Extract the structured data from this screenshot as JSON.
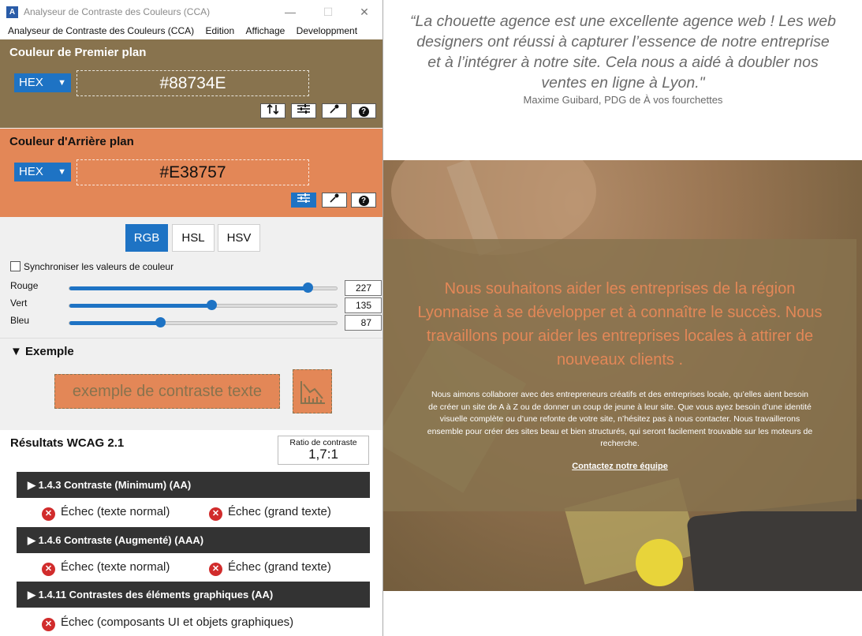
{
  "window": {
    "title": "Analyseur de Contraste des Couleurs (CCA)",
    "app_icon": "cca-logo-icon"
  },
  "menu": {
    "items": [
      "Analyseur de Contraste des Couleurs (CCA)",
      "Edition",
      "Affichage",
      "Developpment"
    ]
  },
  "foreground": {
    "title": "Couleur de Premier plan",
    "format": "HEX",
    "value": "#88734E",
    "color": "#88734e",
    "tools": [
      "swap-icon",
      "sliders-icon",
      "eyedropper-icon",
      "help-icon"
    ]
  },
  "background": {
    "title": "Couleur d'Arrière plan",
    "format": "HEX",
    "value": "#E38757",
    "color": "#e38757",
    "tools": [
      "sliders-icon",
      "eyedropper-icon",
      "help-icon"
    ]
  },
  "color_model": {
    "tabs": [
      "RGB",
      "HSL",
      "HSV"
    ],
    "selected": "RGB"
  },
  "sync_label": "Synchroniser les valeurs de couleur",
  "sliders": [
    {
      "label": "Rouge",
      "value": "227",
      "fraction": 0.89
    },
    {
      "label": "Vert",
      "value": "135",
      "fraction": 0.53
    },
    {
      "label": "Bleu",
      "value": "87",
      "fraction": 0.34
    }
  ],
  "example": {
    "heading": "▼ Exemple",
    "sample_text": "exemple de contraste texte"
  },
  "results": {
    "title": "Résultats WCAG 2.1",
    "ratio_label": "Ratio de contraste",
    "ratio_value": "1,7:1",
    "criteria": [
      {
        "label": "1.4.3 Contraste (Minimum) (AA)",
        "results": [
          "Échec (texte normal)",
          "Échec (grand texte)"
        ]
      },
      {
        "label": "1.4.6 Contraste (Augmenté) (AAA)",
        "results": [
          "Échec (texte normal)",
          "Échec (grand texte)"
        ]
      },
      {
        "label": "1.4.11 Contrastes des éléments graphiques (AA)",
        "results": [
          "Échec (composants UI et objets graphiques)"
        ]
      }
    ]
  },
  "website": {
    "quote": "“La chouette agence est une excellente agence web ! Les web designers ont réussi à capturer l’essence de notre entreprise et à l’intégrer à notre site. Cela nous a aidé à doubler nos ventes en ligne à Lyon.\"",
    "quote_author": "Maxime Guibard, PDG de À vos fourchettes",
    "hero_title": "Nous souhaitons aider les entreprises de la région Lyonnaise à se développer et à connaître le succès. Nous travaillons pour aider les entreprises locales à attirer de nouveaux clients .",
    "hero_text": "Nous aimons collaborer avec des entrepreneurs créatifs et des entreprises locale, qu’elles aient besoin de créer un site de A à Z ou de donner un coup de jeune à leur site. Que vous ayez besoin d’une identité visuelle complète ou d’une refonte de votre site, n’hésitez pas à nous contacter. Nous travaillerons ensemble pour créer des sites beau et bien structurés, qui seront facilement trouvable sur les moteurs de recherche.",
    "cta": "Contactez notre équipe"
  }
}
